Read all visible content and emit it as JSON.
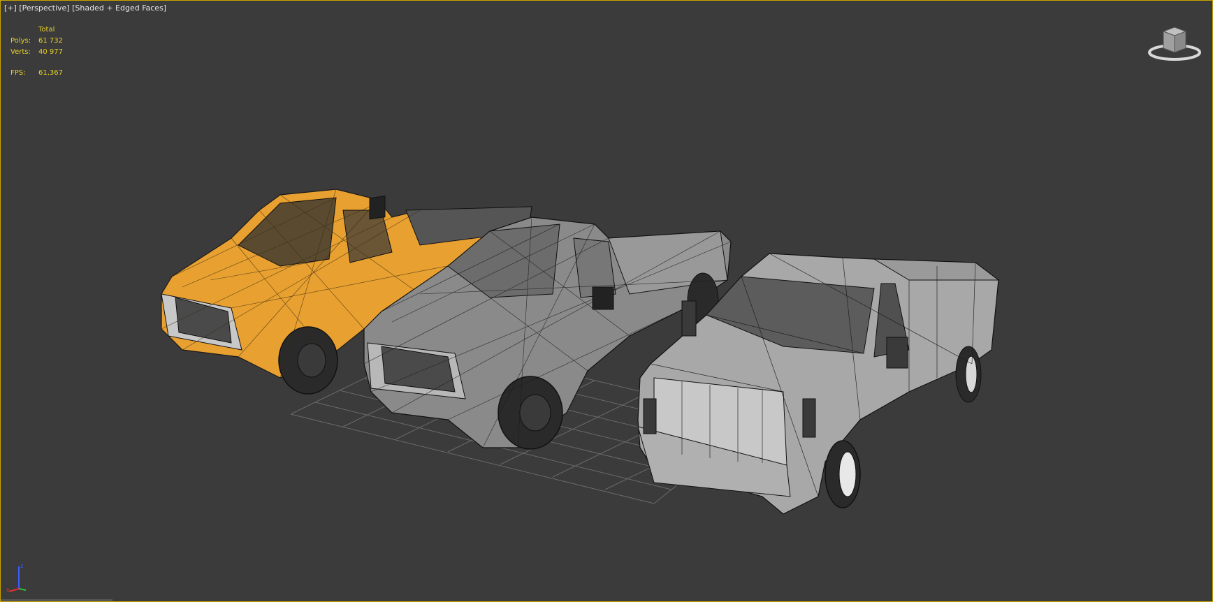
{
  "viewport": {
    "label_plus": "[+]",
    "label_view": "[Perspective]",
    "label_shading": "[Shaded + Edged Faces]"
  },
  "stats": {
    "header": "Total",
    "polys_label": "Polys:",
    "polys_value": "61 732",
    "verts_label": "Verts:",
    "verts_value": "40 977",
    "fps_label": "FPS:",
    "fps_value": "61,367"
  },
  "colors": {
    "viewport_border": "#c8a400",
    "stats_text": "#e8d22a",
    "truck_orange": "#e8a030",
    "truck_gray": "#8a8a8a",
    "truck_light": "#b8b8b8"
  },
  "icons": {
    "viewcube": "viewcube-icon",
    "axis": "axis-tripod-icon"
  }
}
